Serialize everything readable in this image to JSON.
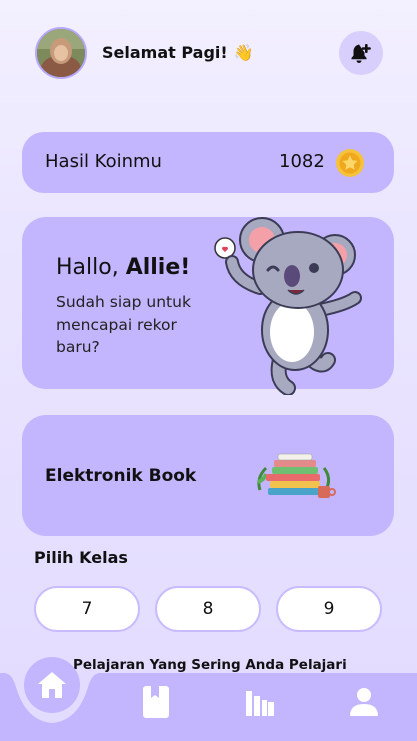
{
  "header": {
    "greeting": "Selamat Pagi!",
    "wave_emoji": "👋",
    "bell_icon": "bell-plus-icon"
  },
  "coins": {
    "label": "Hasil Koinmu",
    "value": "1082",
    "icon": "coin-star-icon"
  },
  "hello": {
    "prefix": "Hallo,",
    "name": "Allie!",
    "subtitle": "Sudah siap untuk mencapai rekor baru?"
  },
  "ebook": {
    "label": "Elektronik Book"
  },
  "kelas": {
    "title": "Pilih Kelas",
    "options": [
      "7",
      "8",
      "9"
    ]
  },
  "subjects": {
    "title": "Pelajaran Yang Sering Anda Pelajari"
  },
  "nav": {
    "items": [
      "home-icon",
      "bookmark-icon",
      "library-icon",
      "profile-icon"
    ],
    "active": "home-icon"
  },
  "colors": {
    "card": "#c3b6ff",
    "nav": "#c3b6ff",
    "accent": "#f4b32c"
  }
}
